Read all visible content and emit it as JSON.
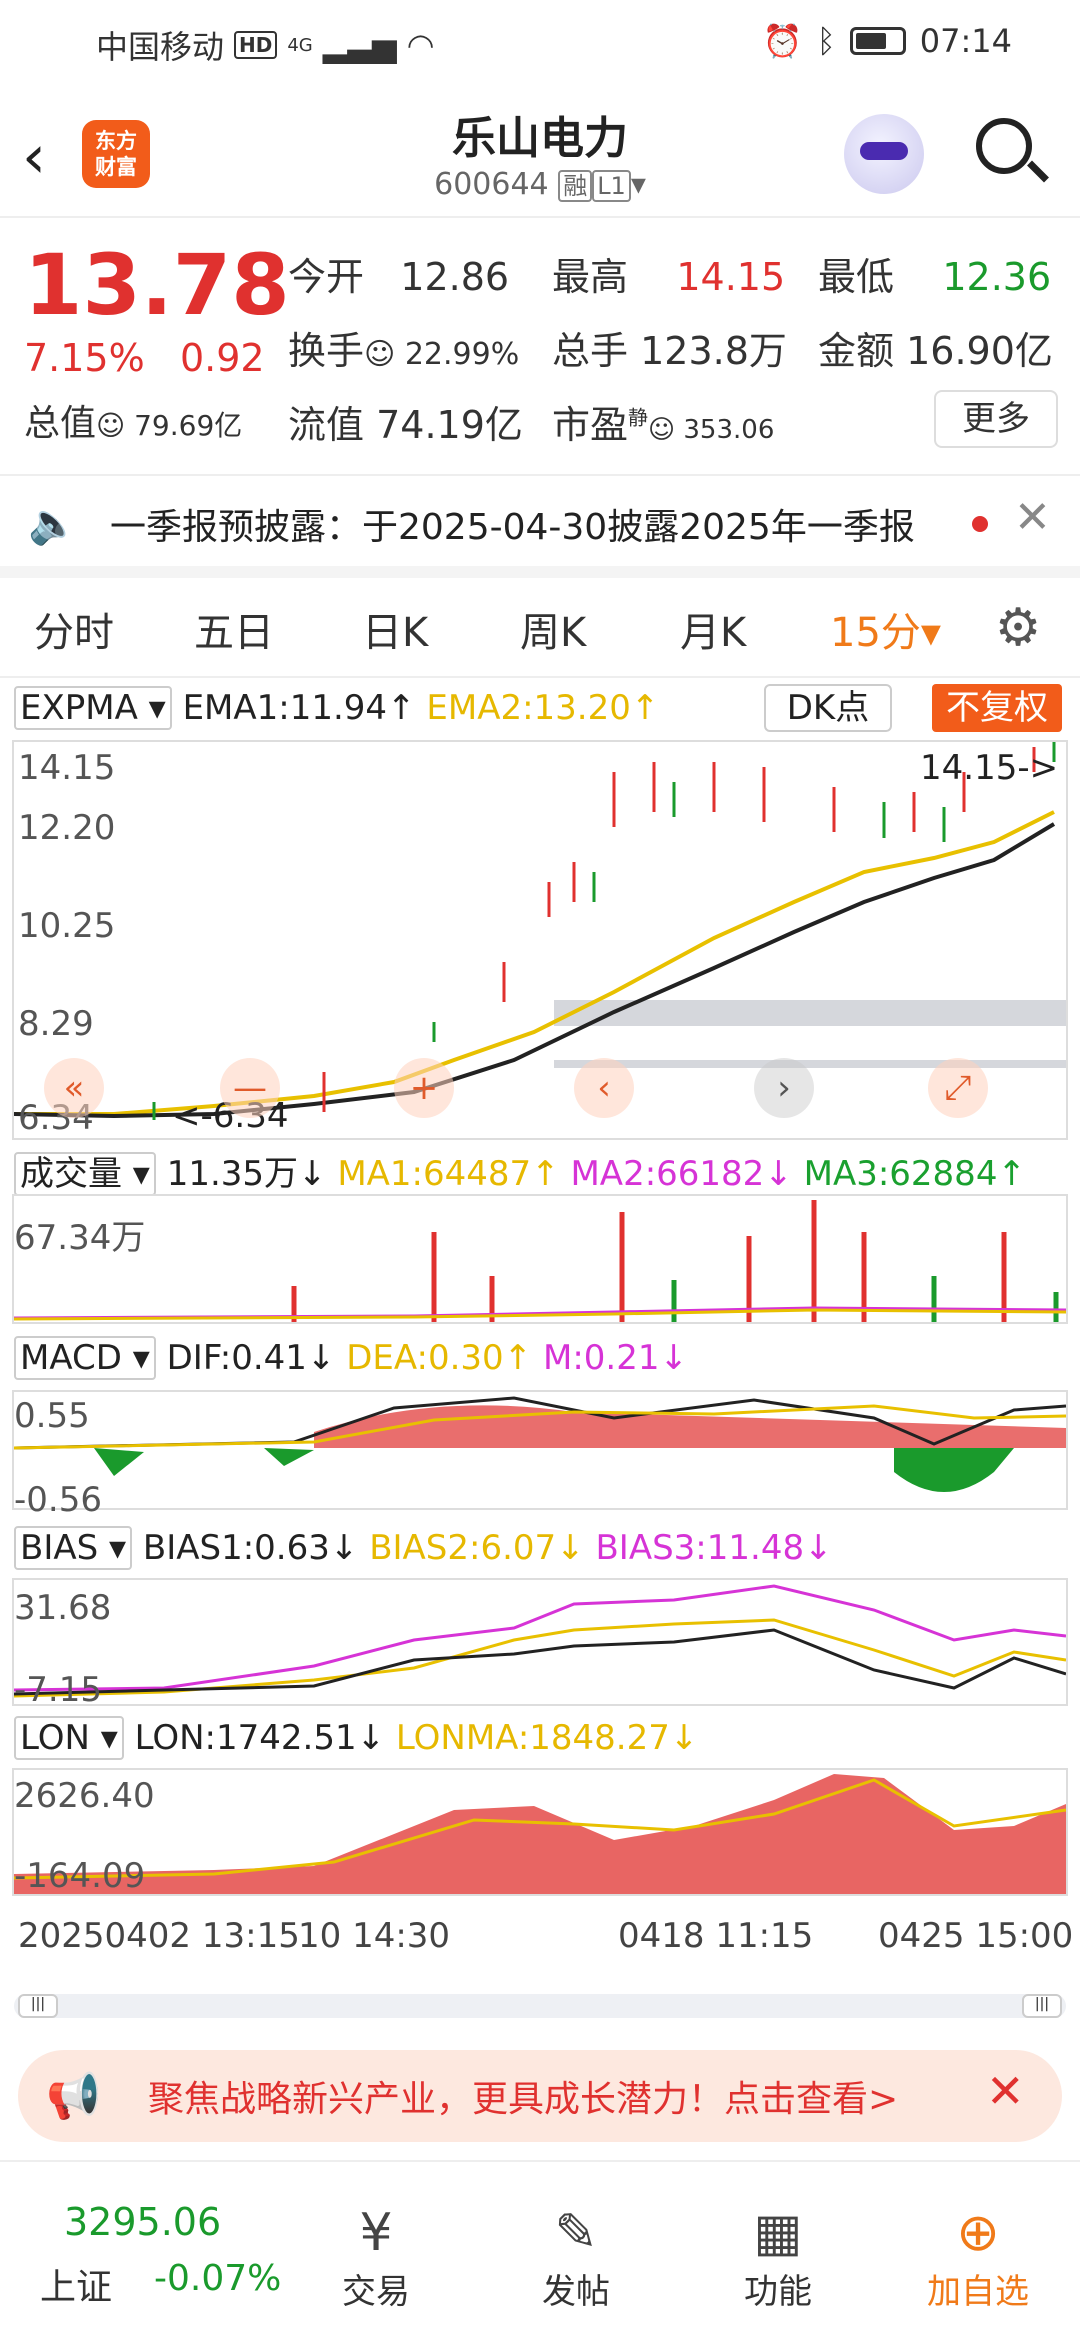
{
  "status": {
    "carrier": "中国移动",
    "hd": "HD",
    "net": "4G",
    "time": "07:14"
  },
  "nav": {
    "back": "‹",
    "logo_l1": "东方",
    "logo_l2": "财富",
    "title": "乐山电力",
    "code": "600644",
    "tag1": "融",
    "tag2": "L1",
    "drop": "▾"
  },
  "quote": {
    "price": "13.78",
    "pct": "7.15%",
    "change": "0.92",
    "open_l": "今开",
    "open": "12.86",
    "high_l": "最高",
    "high": "14.15",
    "low_l": "最低",
    "low": "12.36",
    "turn_l": "换手",
    "turn": "22.99%",
    "vol_l": "总手",
    "vol": "123.8万",
    "amt_l": "金额",
    "amt": "16.90亿",
    "mcap_l": "总值",
    "mcap": "79.69亿",
    "fcap_l": "流值",
    "fcap": "74.19亿",
    "pe_l": "市盈",
    "pe_sup": "静",
    "pe": "353.06",
    "more": "更多"
  },
  "notice": {
    "text": "一季报预披露：于2025-04-30披露2025年一季报"
  },
  "tabs": [
    "分时",
    "五日",
    "日K",
    "周K",
    "月K",
    "15分▾"
  ],
  "ind1": {
    "name": "EXPMA ▾",
    "a": "EMA1:11.94↑",
    "b": "EMA2:13.20↑",
    "dk": "DK点",
    "nofq": "不复权",
    "y": [
      "14.15",
      "12.20",
      "10.25",
      "8.29",
      "6.34"
    ],
    "hi": "14.15->",
    "lo": "<-6.34"
  },
  "ind2": {
    "name": "成交量 ▾",
    "a": "11.35万↓",
    "b": "MA1:64487↑",
    "c": "MA2:66182↓",
    "d": "MA3:62884↑",
    "y": "67.34万"
  },
  "ind3": {
    "name": "MACD ▾",
    "a": "DIF:0.41↓",
    "b": "DEA:0.30↑",
    "c": "M:0.21↓",
    "y1": "0.55",
    "y2": "-0.56"
  },
  "ind4": {
    "name": "BIAS ▾",
    "a": "BIAS1:0.63↓",
    "b": "BIAS2:6.07↓",
    "c": "BIAS3:11.48↓",
    "y1": "31.68",
    "y2": "-7.15"
  },
  "ind5": {
    "name": "LON ▾",
    "a": "LON:1742.51↓",
    "b": "LONMA:1848.27↓",
    "y1": "2626.40",
    "y2": "-164.09"
  },
  "xaxis": {
    "a": "20250402 13:15",
    "b": "10 14:30",
    "c": "0418 11:15",
    "d": "0425 15:00"
  },
  "ad": {
    "text": "聚焦战略新兴产业，更具成长潜力！点击查看>"
  },
  "bottom": {
    "idx": "3295.06",
    "idx_name": "上证",
    "idx_chg": "-0.07%",
    "t1": "交易",
    "t2": "发帖",
    "t3": "功能",
    "t4": "加自选"
  }
}
